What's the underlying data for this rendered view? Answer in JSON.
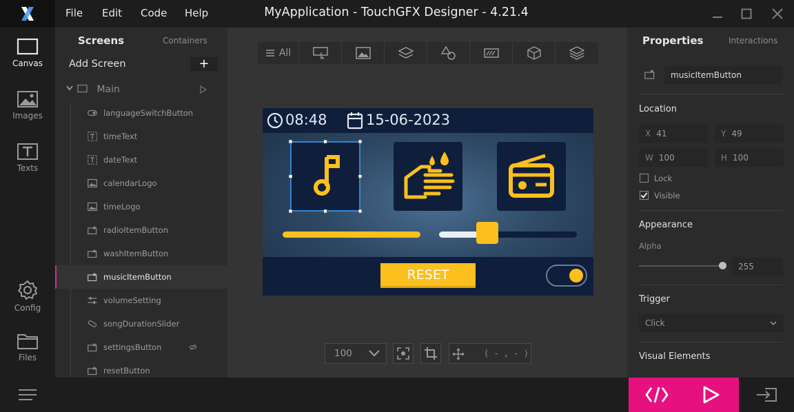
{
  "titlebar": {
    "title": "MyApplication - TouchGFX Designer - 4.21.4",
    "menus": [
      "File",
      "Edit",
      "Code",
      "Help"
    ]
  },
  "rail": {
    "items": [
      {
        "label": "Canvas",
        "icon": "canvas-icon"
      },
      {
        "label": "Images",
        "icon": "images-icon"
      },
      {
        "label": "Texts",
        "icon": "texts-icon"
      },
      {
        "label": "Config",
        "icon": "gear-icon"
      },
      {
        "label": "Files",
        "icon": "folder-icon"
      }
    ]
  },
  "tree": {
    "tab_screens": "Screens",
    "tab_containers": "Containers",
    "add_screen": "Add Screen",
    "add_symbol": "+",
    "screen_name": "Main",
    "nodes": [
      {
        "label": "languageSwitchButton",
        "icon": "toggle-icon"
      },
      {
        "label": "timeText",
        "icon": "text-icon"
      },
      {
        "label": "dateText",
        "icon": "text-icon"
      },
      {
        "label": "calendarLogo",
        "icon": "image-icon"
      },
      {
        "label": "timeLogo",
        "icon": "image-icon"
      },
      {
        "label": "radioItemButton",
        "icon": "button-icon"
      },
      {
        "label": "washItemButton",
        "icon": "button-icon"
      },
      {
        "label": "musicItemButton",
        "icon": "button-icon",
        "selected": true
      },
      {
        "label": "volumeSetting",
        "icon": "slider-icon"
      },
      {
        "label": "songDurationSlider",
        "icon": "progress-icon"
      },
      {
        "label": "settingsButton",
        "icon": "button-icon"
      },
      {
        "label": "resetButton",
        "icon": "button-icon"
      }
    ]
  },
  "toolbar": {
    "all_label": "All"
  },
  "device": {
    "time": "08:48",
    "date": "15-06-2023",
    "reset": "RESET",
    "progress_fraction": 1.0,
    "volume_fraction": 0.35,
    "toggle_on": true,
    "accent": "#fbbf1e",
    "panel": "#0f1e3a"
  },
  "canvas_controls": {
    "zoom": "100",
    "coords": "( - , - )"
  },
  "props": {
    "tab_properties": "Properties",
    "tab_interactions": "Interactions",
    "name": "musicItemButton",
    "location_title": "Location",
    "x_key": "X",
    "x": "41",
    "y_key": "Y",
    "y": "49",
    "w_key": "W",
    "w": "100",
    "h_key": "H",
    "h": "100",
    "lock_label": "Lock",
    "visible_label": "Visible",
    "appearance_title": "Appearance",
    "alpha_label": "Alpha",
    "alpha_value": "255",
    "trigger_title": "Trigger",
    "trigger_value": "Click",
    "visual_title": "Visual Elements"
  }
}
